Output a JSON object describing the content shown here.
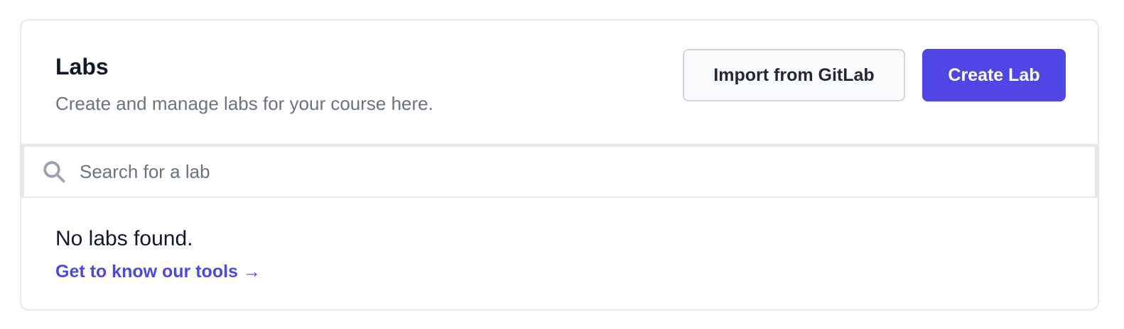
{
  "labs": {
    "title": "Labs",
    "subtitle": "Create and manage labs for your course here.",
    "import_label": "Import from GitLab",
    "create_label": "Create Lab"
  },
  "search": {
    "icon": "search-icon",
    "placeholder": "Search for a lab",
    "value": ""
  },
  "empty_state": {
    "message": "No labs found.",
    "link_label": "Get to know our tools →"
  },
  "colors": {
    "accent": "#4f46e5",
    "border": "#e5e7eb",
    "muted_text": "#6b7280",
    "text": "#111827"
  }
}
